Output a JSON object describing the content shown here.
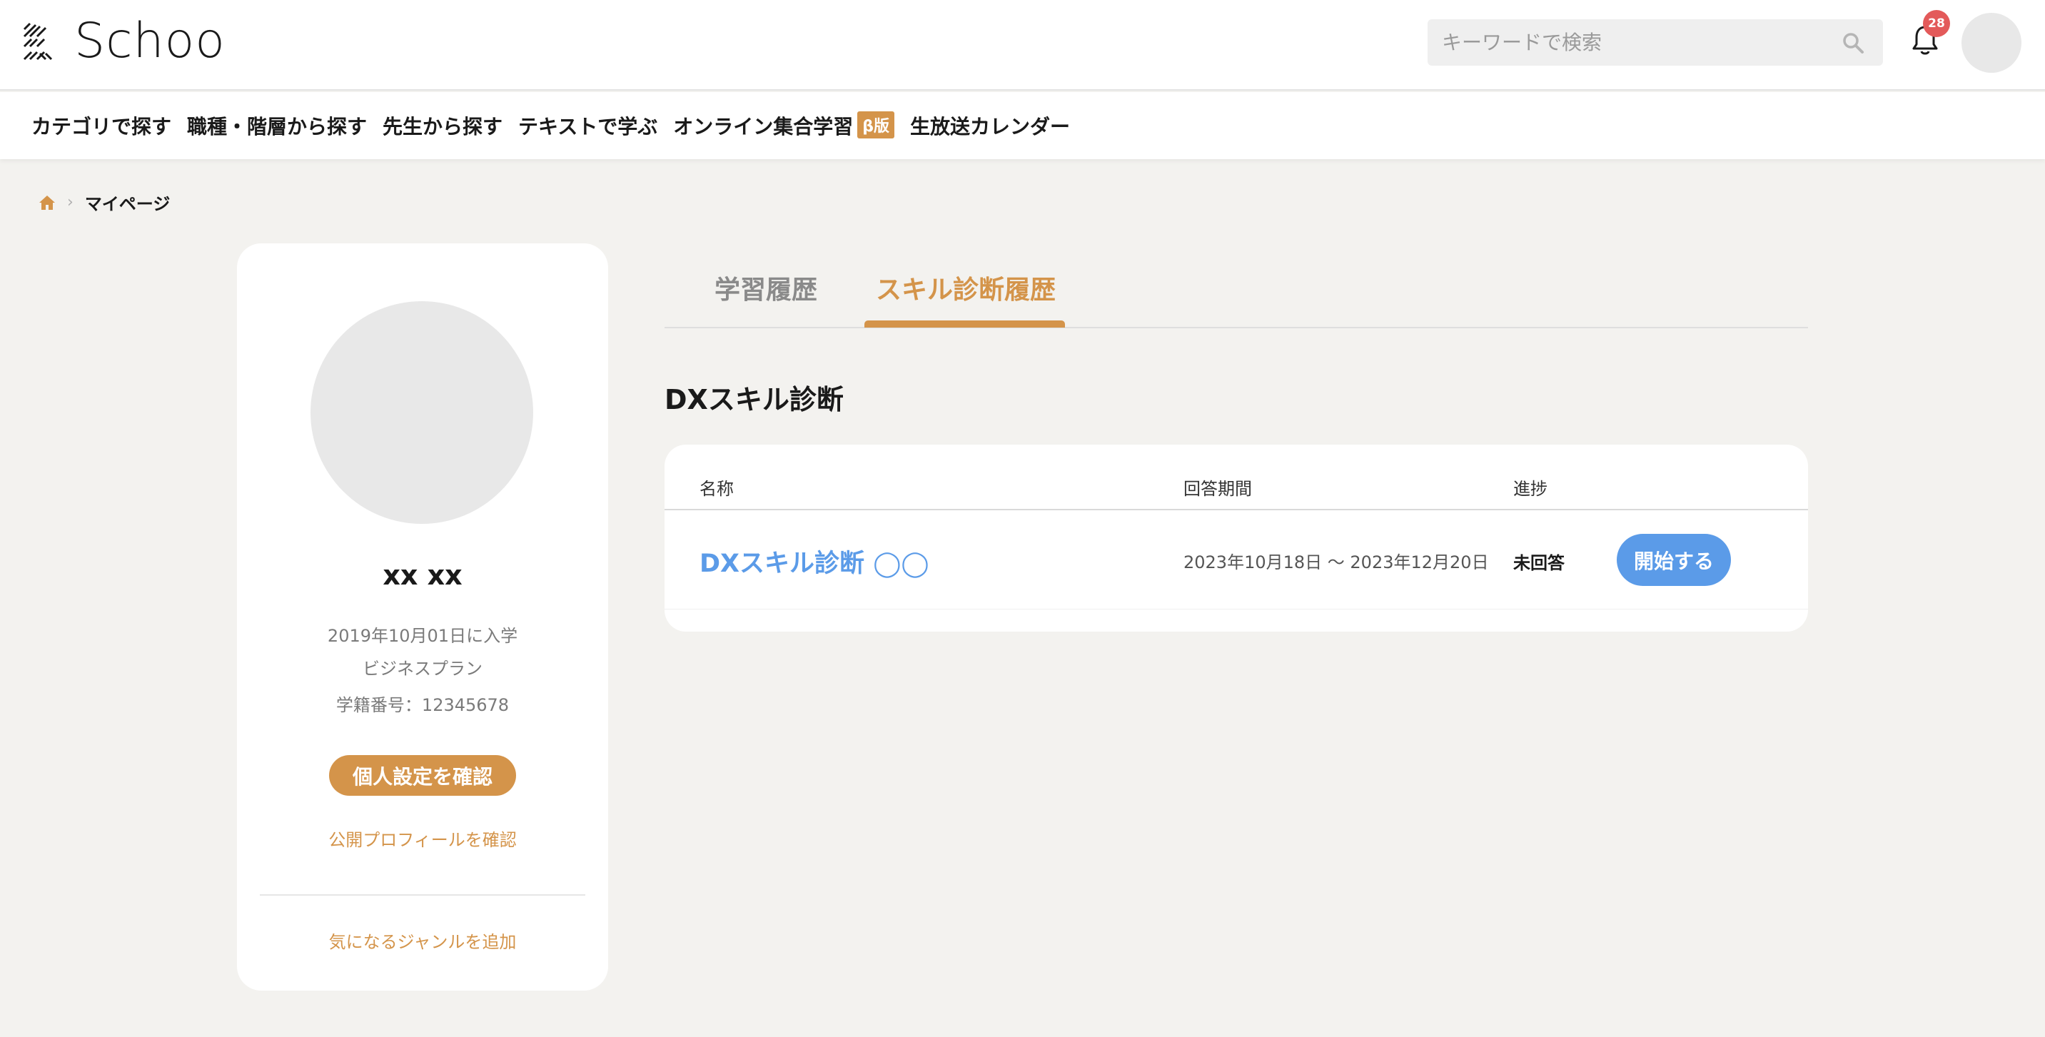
{
  "header": {
    "logo_text": "Schoo",
    "search_placeholder": "キーワードで検索",
    "notification_count": "28",
    "icons": [
      "logo-mark-icon",
      "search-icon",
      "bell-icon",
      "home-icon"
    ],
    "accent_color": "#d4944a",
    "link_color": "#5b9be8"
  },
  "nav": {
    "items": [
      {
        "label": "カテゴリで探す"
      },
      {
        "label": "職種・階層から探す"
      },
      {
        "label": "先生から探す"
      },
      {
        "label": "テキストで学ぶ"
      },
      {
        "label": "オンライン集合学習",
        "badge": "β版"
      },
      {
        "label": "生放送カレンダー"
      }
    ]
  },
  "breadcrumb": {
    "separator": "›",
    "current": "マイページ"
  },
  "profile": {
    "name": "xx xx",
    "enrolled": "2019年10月01日に入学",
    "plan": "ビジネスプラン",
    "student_id": "学籍番号：12345678",
    "settings_button": "個人設定を確認",
    "public_profile_link": "公開プロフィールを確認",
    "add_genre_link": "気になるジャンルを追加"
  },
  "tabs": [
    {
      "label": "学習履歴",
      "active": false
    },
    {
      "label": "スキル診断履歴",
      "active": true
    }
  ],
  "section": {
    "title": "DXスキル診断"
  },
  "table": {
    "headers": {
      "name": "名称",
      "period": "回答期間",
      "progress": "進捗"
    },
    "rows": [
      {
        "name": "DXスキル診断 ◯◯",
        "period": "2023年10月18日 〜 2023年12月20日",
        "status": "未回答",
        "action": "開始する"
      }
    ]
  }
}
